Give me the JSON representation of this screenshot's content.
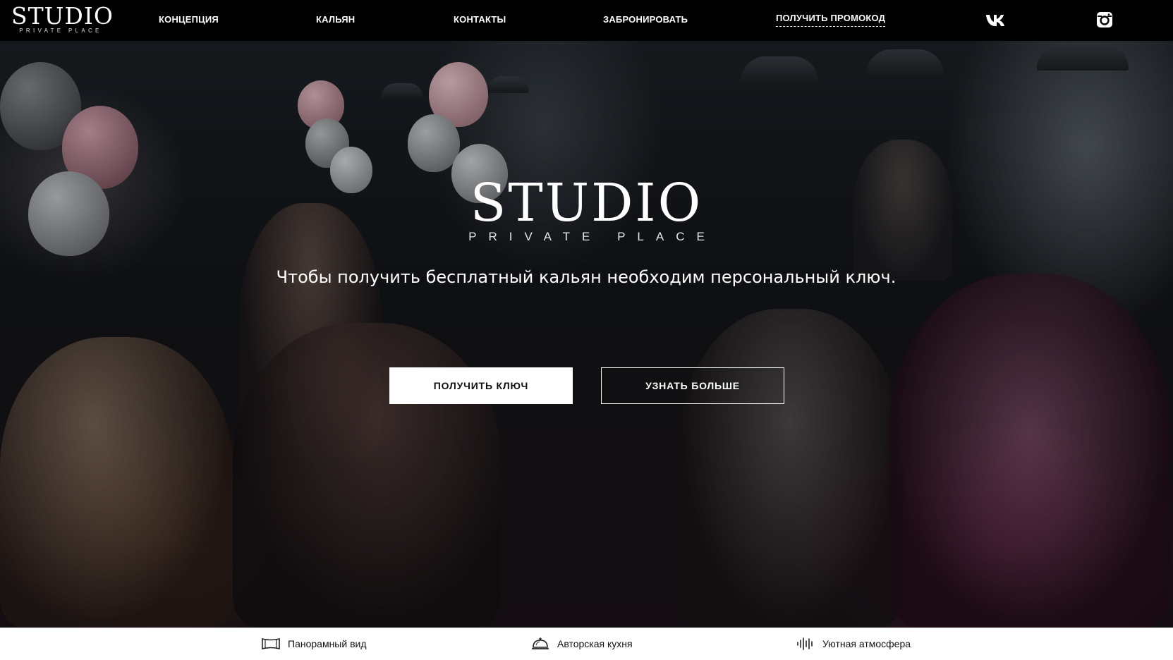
{
  "header": {
    "logo": {
      "brand": "STUDIO",
      "tagline": "PRIVATE PLACE"
    },
    "nav": [
      {
        "label": "КОНЦЕПЦИЯ"
      },
      {
        "label": "КАЛЬЯН"
      },
      {
        "label": "КОНТАКТЫ"
      },
      {
        "label": "ЗАБРОНИРОВАТЬ"
      },
      {
        "label": "ПОЛУЧИТЬ ПРОМОКОД"
      }
    ],
    "social": [
      {
        "name": "vk-icon"
      },
      {
        "name": "instagram-icon"
      }
    ]
  },
  "hero": {
    "logo": {
      "brand": "STUDIO",
      "tagline": "PRIVATE PLACE"
    },
    "text": "Чтобы получить бесплатный кальян необходим персональный ключ.",
    "primary_button": "ПОЛУЧИТЬ КЛЮЧ",
    "secondary_button": "УЗНАТЬ БОЛЬШЕ"
  },
  "features": [
    {
      "icon": "panorama-icon",
      "label": "Панорамный вид"
    },
    {
      "icon": "cloche-icon",
      "label": "Авторская кухня"
    },
    {
      "icon": "sound-wave-icon",
      "label": "Уютная атмосфера"
    }
  ],
  "colors": {
    "header_bg": "#000000",
    "button_bg": "#ffffff",
    "features_bg": "#ffffff"
  }
}
